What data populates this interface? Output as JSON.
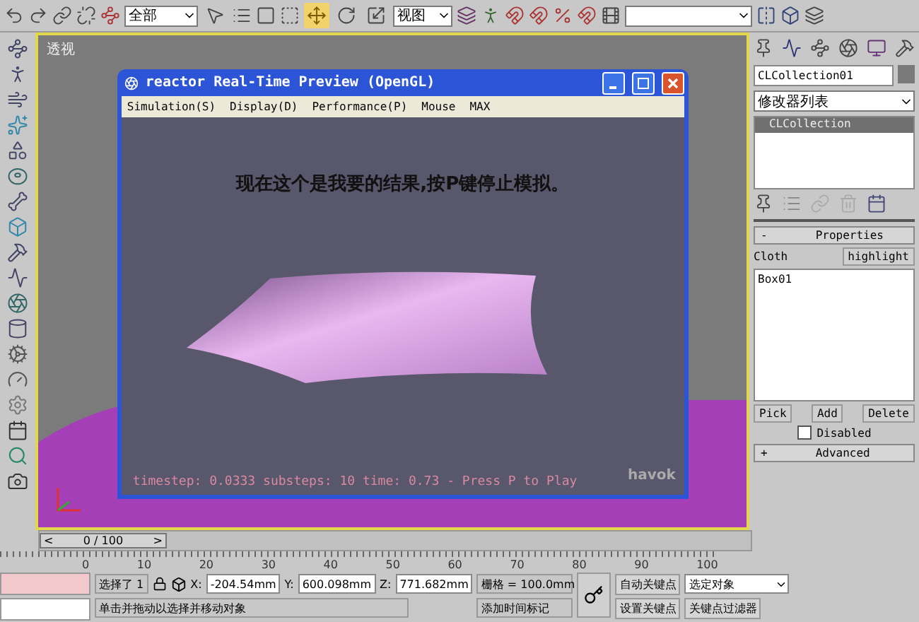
{
  "toolbar": {
    "selection_filter": "全部",
    "reference_coord": "视图",
    "transform_tools": [
      {
        "selected": false
      },
      {
        "selected": true
      },
      {
        "selected": false
      },
      {
        "selected": false
      }
    ]
  },
  "viewport": {
    "label": "透视"
  },
  "preview_window": {
    "title": "reactor Real-Time Preview (OpenGL)",
    "menu": [
      "Simulation(S)",
      "Display(D)",
      "Performance(P)",
      "Mouse",
      "MAX"
    ],
    "message": "现在这个是我要的结果,按P键停止模拟。",
    "status": "timestep: 0.0333 substeps: 10 time: 0.73 - Press P to Play",
    "logo": "havok"
  },
  "command_panel": {
    "object_name": "CLCollection01",
    "modifier_list": "修改器列表",
    "stack": [
      {
        "label": "CLCollection",
        "selected": true
      }
    ],
    "properties": {
      "header": "Properties",
      "collapse_sign": "-",
      "label": "Cloth",
      "highlight_button": "highlight",
      "items": [
        "Box01"
      ],
      "buttons": [
        "Pick",
        "Add",
        "Delete"
      ],
      "disabled_label": "Disabled",
      "disabled": false
    },
    "advanced": {
      "header": "Advanced",
      "expand_sign": "+"
    }
  },
  "time_slider": {
    "level": 0,
    "position": "0 / 100",
    "prev": "<",
    "next": ">"
  },
  "ruler_labels": [
    "0",
    "10",
    "20",
    "30",
    "40",
    "50",
    "60",
    "70",
    "80",
    "90",
    "100"
  ],
  "status_bar": {
    "selection": "选择了 1",
    "x": "-204.54mm",
    "y": "600.098mm",
    "z": "771.682mm",
    "x_label": "X:",
    "y_label": "Y:",
    "z_label": "Z:",
    "grid": "栅格 = 100.0mm",
    "prompt": "单击并拖动以选择并移动对象",
    "time_tag": "添加时间标记",
    "auto_key": "自动关键点",
    "set_key": "设置关键点",
    "key_mode": "选定对象",
    "key_filters": "关键点过滤器"
  }
}
